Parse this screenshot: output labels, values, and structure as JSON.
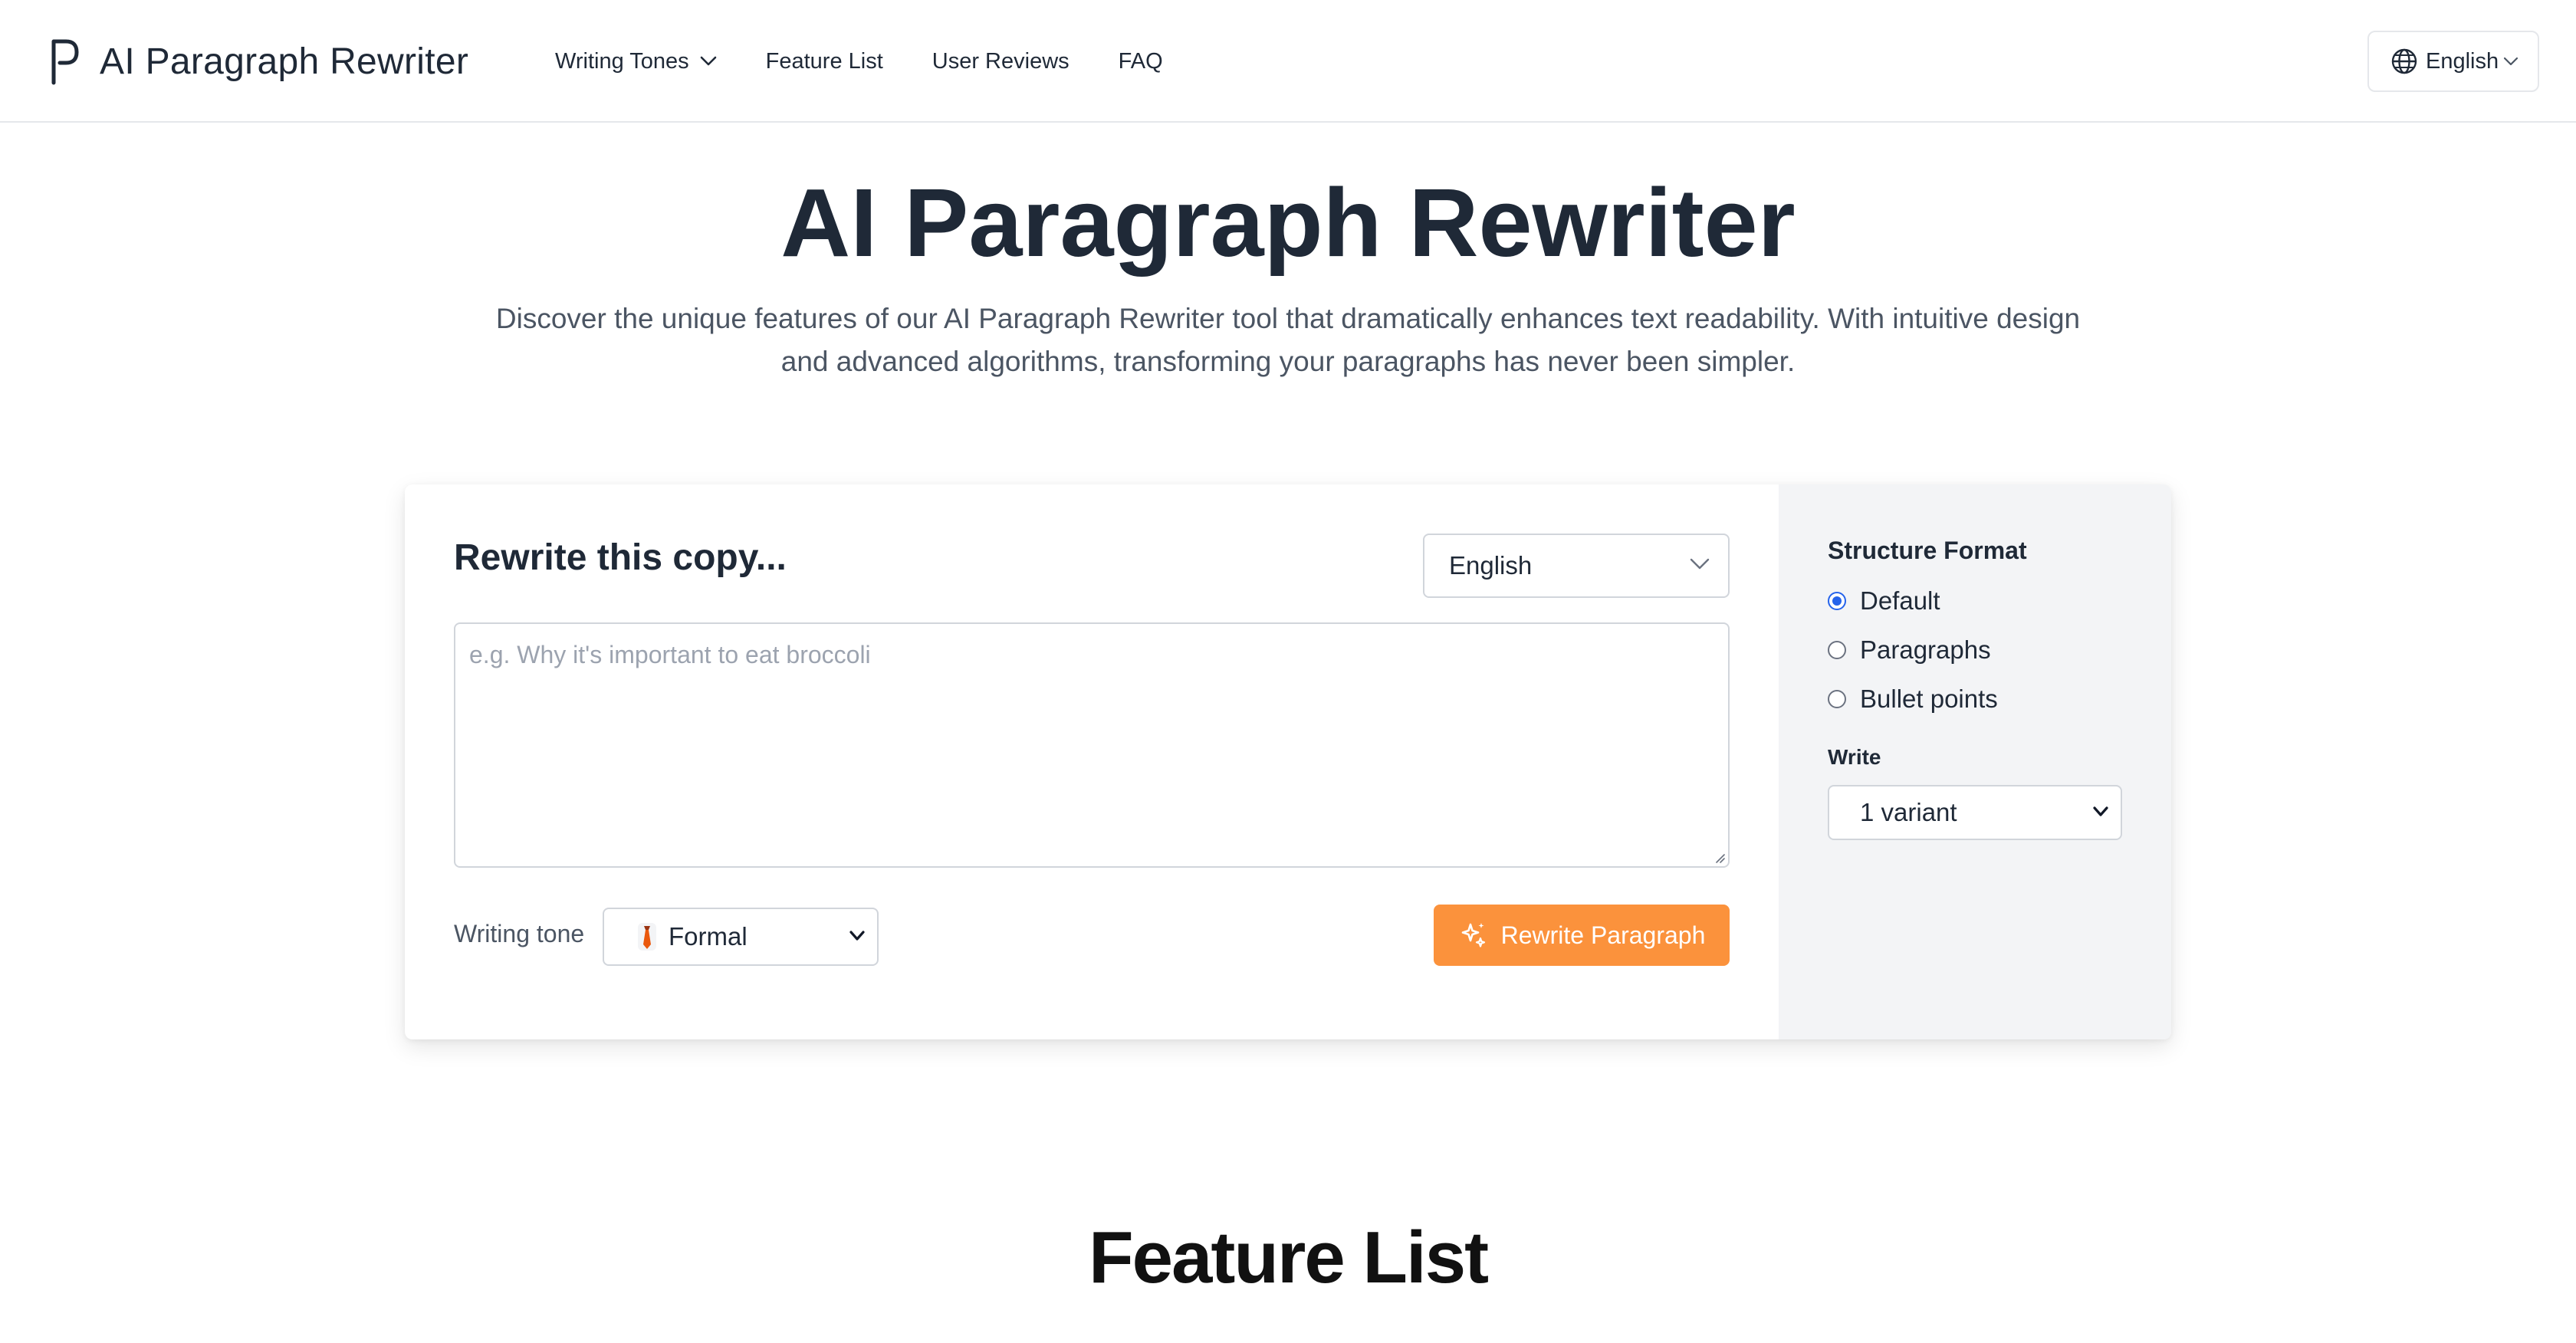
{
  "header": {
    "brand_name": "AI Paragraph Rewriter",
    "nav": {
      "writing_tones": "Writing Tones",
      "feature_list": "Feature List",
      "user_reviews": "User Reviews",
      "faq": "FAQ"
    },
    "language": "English"
  },
  "hero": {
    "title": "AI Paragraph Rewriter",
    "description": "Discover the unique features of our AI Paragraph Rewriter tool that dramatically enhances text readability. With intuitive design and advanced algorithms, transforming your paragraphs has never been simpler."
  },
  "tool": {
    "heading": "Rewrite this copy...",
    "language_select": "English",
    "input_placeholder": "e.g. Why it's important to eat broccoli",
    "input_value": "",
    "tone_label": "Writing tone",
    "tone_value": "Formal",
    "tone_icon": "necktie-icon",
    "rewrite_button": "Rewrite Paragraph",
    "accent_color": "#fb923c"
  },
  "side": {
    "structure_heading": "Structure Format",
    "options": [
      "Default",
      "Paragraphs",
      "Bullet points"
    ],
    "selected": "Default",
    "write_label": "Write",
    "variant_value": "1 variant"
  },
  "features": {
    "title": "Feature List"
  }
}
